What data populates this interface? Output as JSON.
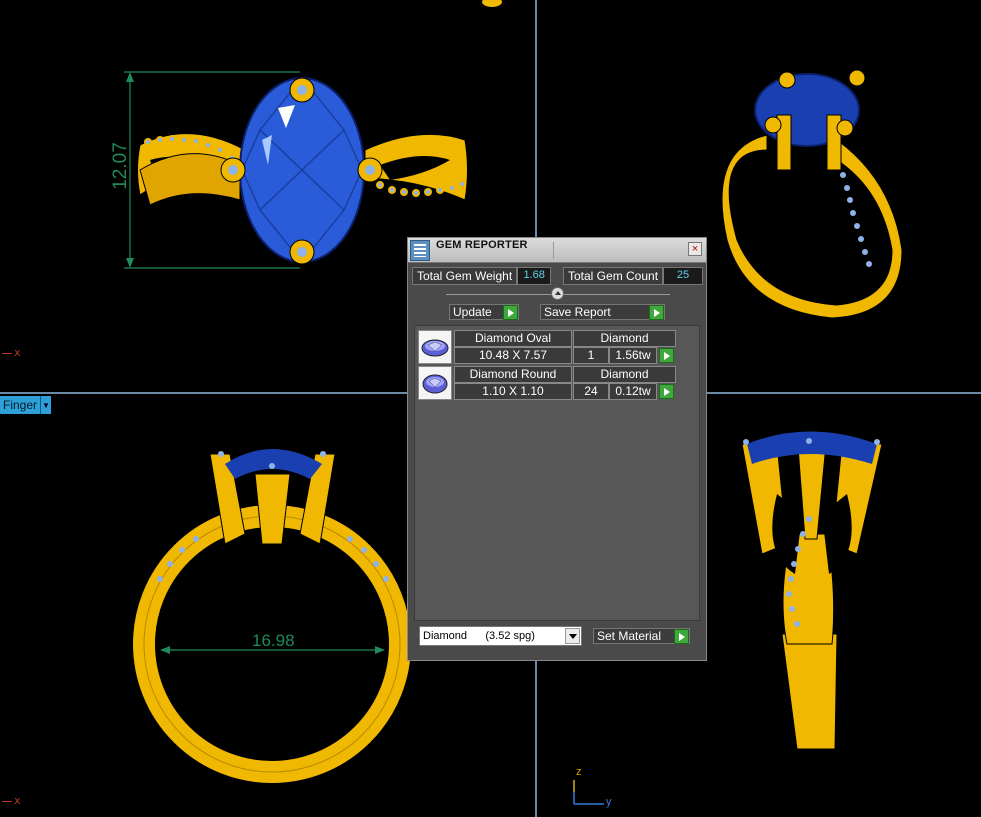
{
  "viewports": {
    "top_left": {
      "dimension_label": "12.07",
      "axis_label": "x"
    },
    "bottom_left": {
      "dimension_label": "16.98",
      "axis_label": "x",
      "view_name": "Finger"
    },
    "bottom_right": {
      "axis_z": "z",
      "axis_y": "y"
    }
  },
  "gem_reporter": {
    "title": "GEM REPORTER",
    "total_weight_label": "Total Gem Weight",
    "total_weight_value": "1.68",
    "total_count_label": "Total Gem Count",
    "total_count_value": "25",
    "update_label": "Update",
    "save_report_label": "Save Report",
    "rows": [
      {
        "shape": "Diamond Oval",
        "material": "Diamond",
        "size": "10.48 X 7.57",
        "count": "1",
        "weight": "1.56tw"
      },
      {
        "shape": "Diamond Round",
        "material": "Diamond",
        "size": "1.10 X 1.10",
        "count": "24",
        "weight": "0.12tw"
      }
    ],
    "material_select_value": "Diamond      (3.52 spg)",
    "set_material_label": "Set Material"
  },
  "colors": {
    "metal": "#f0b800",
    "gem": "#1a3fb0",
    "panel_bg": "#4a4a4a",
    "value_cyan": "#5fd4e8",
    "dimension_green": "#1f8a5a"
  }
}
